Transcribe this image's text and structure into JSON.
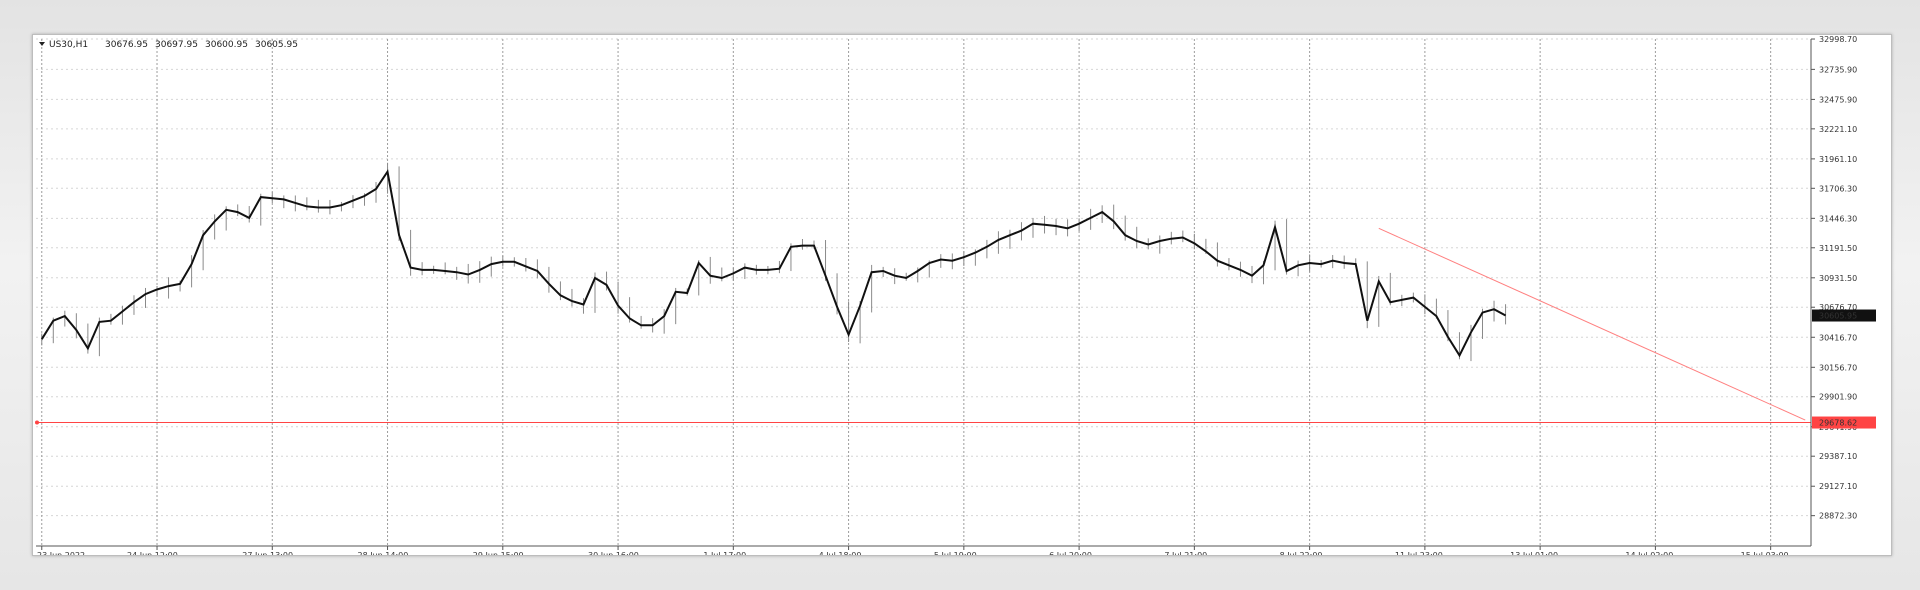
{
  "header": {
    "symbol": "US30,H1",
    "open": "30676.95",
    "high": "30697.95",
    "low": "30600.95",
    "close": "30605.95"
  },
  "chart_data": {
    "type": "line",
    "title": "",
    "xlabel": "",
    "ylabel": "",
    "ylim": [
      28609.64,
      32998.9
    ],
    "grid": true,
    "y_ticks": [
      "32998.70",
      "32735.90",
      "32475.90",
      "32221.10",
      "31961.10",
      "31706.30",
      "31446.30",
      "31191.50",
      "30931.50",
      "30676.70",
      "30416.70",
      "30156.70",
      "29901.90",
      "29641.90",
      "29387.10",
      "29127.10",
      "28872.30"
    ],
    "x_ticks": [
      "23 Jun 2022",
      "24 Jun 12:00",
      "27 Jun 13:00",
      "28 Jun 14:00",
      "29 Jun 15:00",
      "30 Jun 16:00",
      "1 Jul 17:00",
      "4 Jul 18:00",
      "5 Jul 19:00",
      "6 Jul 20:00",
      "7 Jul 21:00",
      "8 Jul 22:00",
      "11 Jul 23:00",
      "13 Jul 01:00",
      "14 Jul 02:00",
      "15 Jul 03:00"
    ],
    "current_price_label": "30605.95",
    "horizontal_line_label": "29678.62",
    "horizontal_line_value": 29678.62,
    "series": [
      {
        "values": [
          30400,
          30560,
          30600,
          30480,
          30320,
          30550,
          30560,
          30640,
          30720,
          30790,
          30830,
          30860,
          30880,
          31050,
          31300,
          31420,
          31520,
          31500,
          31450,
          31630,
          31620,
          31610,
          31580,
          31550,
          31540,
          31540,
          31560,
          31600,
          31640,
          31700,
          31850,
          31300,
          31020,
          31000,
          31000,
          30990,
          30980,
          30960,
          31000,
          31050,
          31070,
          31070,
          31030,
          30990,
          30880,
          30780,
          30730,
          30700,
          30930,
          30870,
          30690,
          30580,
          30520,
          30520,
          30600,
          30810,
          30800,
          31060,
          30950,
          30930,
          30970,
          31020,
          31000,
          31000,
          31010,
          31200,
          31210,
          31210,
          30950,
          30680,
          30440,
          30690,
          30980,
          30990,
          30950,
          30930,
          30990,
          31060,
          31090,
          31080,
          31110,
          31150,
          31200,
          31260,
          31300,
          31340,
          31400,
          31390,
          31380,
          31360,
          31400,
          31450,
          31500,
          31420,
          31300,
          31250,
          31220,
          31250,
          31270,
          31280,
          31230,
          31160,
          31080,
          31040,
          31000,
          30950,
          31040,
          31370,
          30990,
          31040,
          31060,
          31050,
          31080,
          31060,
          31050,
          30560,
          30900,
          30720,
          30740,
          30760,
          30680,
          30600,
          30420,
          30260,
          30460,
          30630,
          30660,
          30605
        ]
      }
    ],
    "trendline": {
      "start": {
        "x_index": 116,
        "y": 31360
      },
      "end": {
        "x_index": 153,
        "y": 29700
      }
    }
  },
  "colors": {
    "price_line": "#111111",
    "wick": "#8a8a8a",
    "red": "#ff4444",
    "trendline": "#ff8080",
    "grid": "#bfbfbf"
  }
}
